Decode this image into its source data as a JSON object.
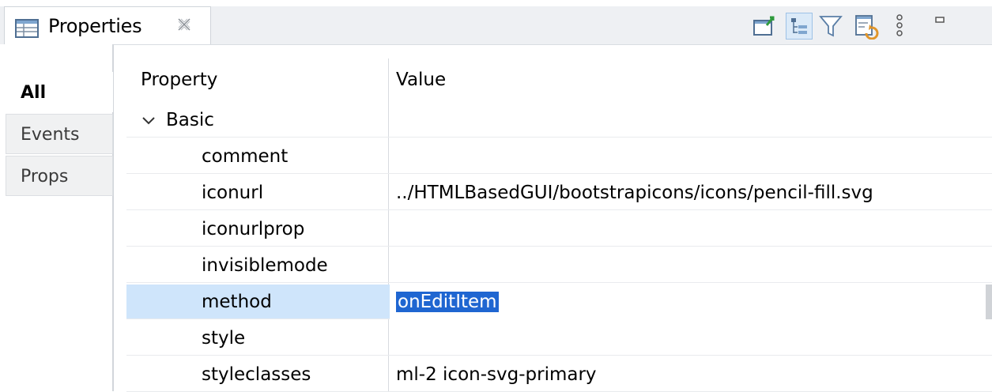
{
  "view": {
    "title": "Properties",
    "toolbar": [
      {
        "name": "pin-to-selection-icon",
        "active": false
      },
      {
        "name": "show-categories-icon",
        "active": true
      },
      {
        "name": "filter-icon",
        "active": false
      },
      {
        "name": "restore-default-icon",
        "active": false
      },
      {
        "name": "view-menu-icon",
        "active": false
      }
    ]
  },
  "sidebar": {
    "tabs": [
      {
        "label": "All",
        "selected": true
      },
      {
        "label": "Events",
        "selected": false
      },
      {
        "label": "Props",
        "selected": false
      }
    ]
  },
  "table": {
    "headers": {
      "property": "Property",
      "value": "Value"
    },
    "group": {
      "label": "Basic",
      "expanded": true
    },
    "rows": [
      {
        "name": "comment",
        "value": ""
      },
      {
        "name": "iconurl",
        "value": "../HTMLBasedGUI/bootstrapicons/icons/pencil-fill.svg"
      },
      {
        "name": "iconurlprop",
        "value": ""
      },
      {
        "name": "invisiblemode",
        "value": ""
      },
      {
        "name": "method",
        "value": "onEditItem",
        "selected": true
      },
      {
        "name": "style",
        "value": ""
      },
      {
        "name": "styleclasses",
        "value": "ml-2 icon-svg-primary"
      }
    ]
  },
  "colors": {
    "selection": "#cfe5fb",
    "text_highlight": "#1f66d1"
  }
}
